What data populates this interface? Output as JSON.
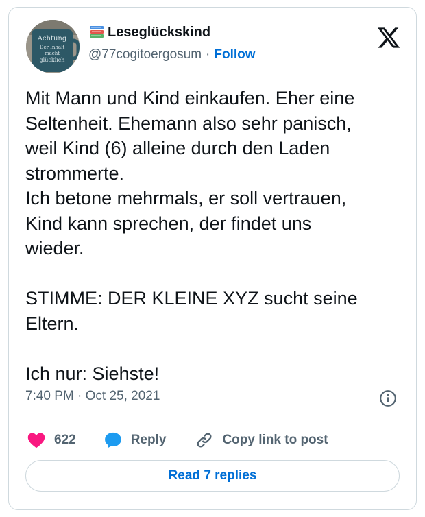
{
  "author": {
    "display_name": "Leseglückskind",
    "handle": "@77cogitoergosum",
    "separator": "·",
    "follow_label": "Follow",
    "avatar_text": [
      "Achtung",
      "Der Inhalt",
      "macht",
      "glücklich"
    ]
  },
  "tweet": {
    "text": "Mit Mann und Kind einkaufen. Eher eine\nSeltenheit. Ehemann also sehr panisch,\nweil Kind (6) alleine durch den Laden\nstrommerte.\nIch betone mehrmals, er soll vertrauen,\nKind kann sprechen, der findet uns\nwieder.\n\nSTIMME: DER KLEINE XYZ sucht seine\nEltern.\n\nIch nur: Siehste!",
    "timestamp": "7:40 PM · Oct 25, 2021"
  },
  "actions": {
    "like_count": "622",
    "reply_label": "Reply",
    "copy_link_label": "Copy link to post"
  },
  "read_replies_label": "Read 7 replies",
  "icons": {
    "platform": "x-logo-icon",
    "verified_books": "books-emoji-icon",
    "like": "heart-icon",
    "reply": "speech-bubble-icon",
    "copy": "link-icon",
    "info": "info-icon"
  },
  "colors": {
    "link_blue": "#006fd6",
    "heart_pink": "#f91880",
    "reply_blue": "#1d9bf0",
    "muted": "#536471",
    "border": "#cfd9de"
  }
}
